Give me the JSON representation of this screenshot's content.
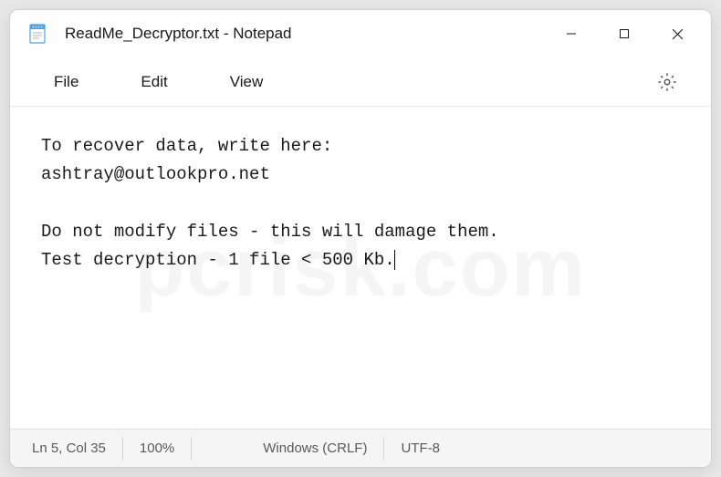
{
  "titlebar": {
    "title": "ReadMe_Decryptor.txt - Notepad"
  },
  "menubar": {
    "file": "File",
    "edit": "Edit",
    "view": "View"
  },
  "content": {
    "text": "To recover data, write here:\nashtray@outlookpro.net\n\nDo not modify files - this will damage them.\nTest decryption - 1 file < 500 Kb."
  },
  "statusbar": {
    "position": "Ln 5, Col 35",
    "zoom": "100%",
    "lineending": "Windows (CRLF)",
    "encoding": "UTF-8"
  },
  "watermark": "pcrisk.com"
}
